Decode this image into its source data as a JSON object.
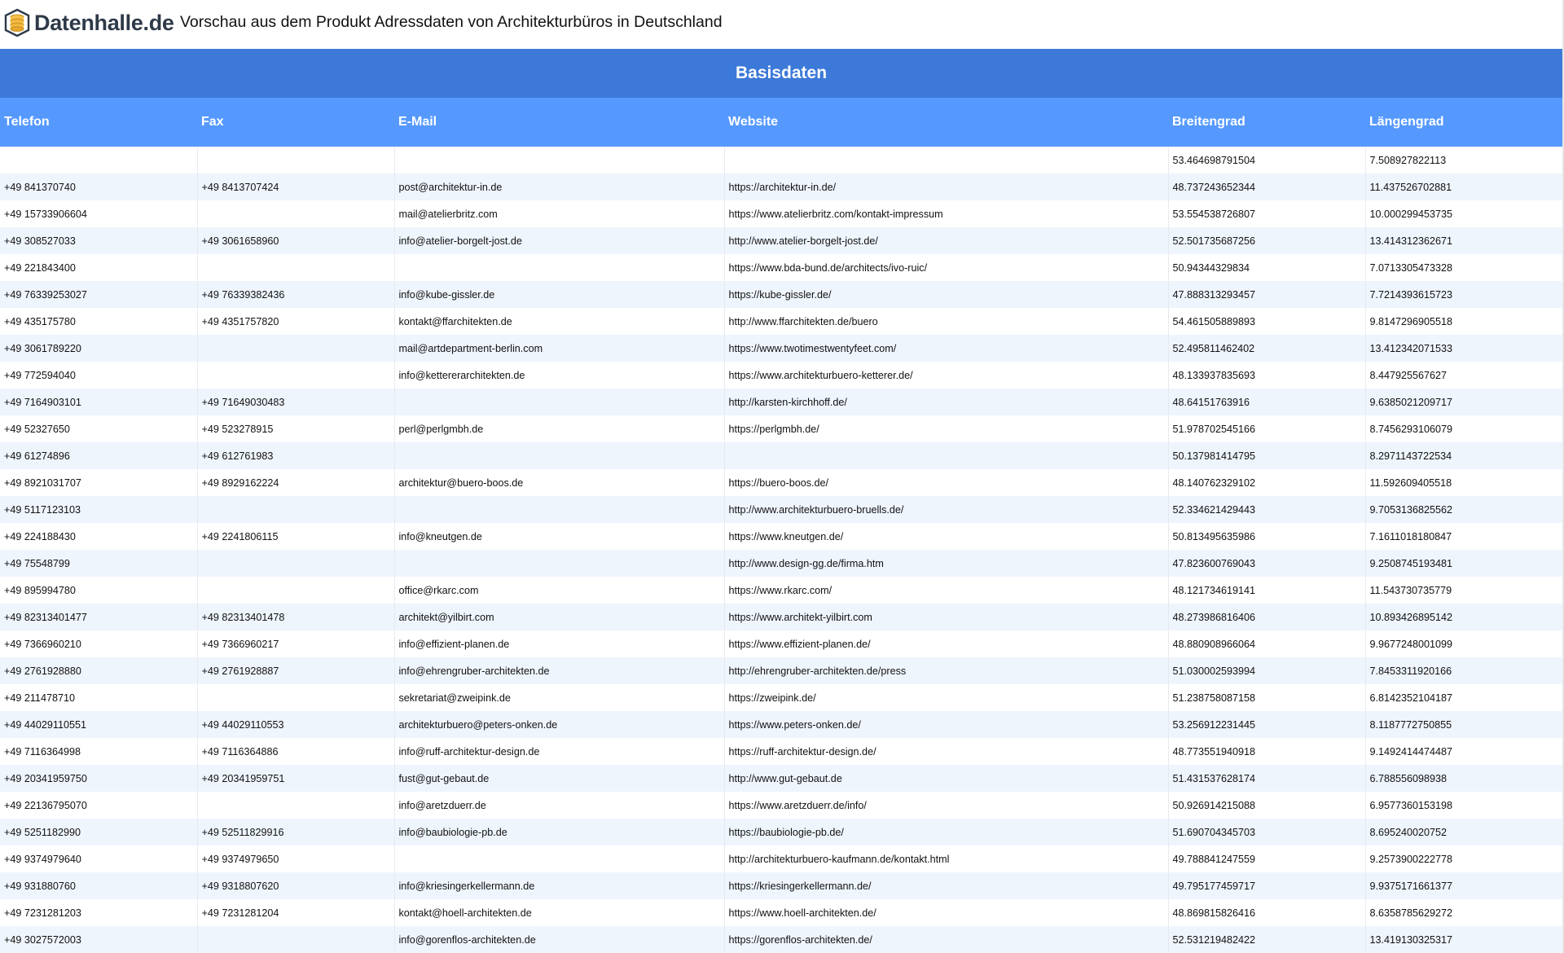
{
  "header": {
    "logo_text": "Datenhalle.de",
    "title": "Vorschau aus dem Produkt Adressdaten von Architekturbüros in Deutschland"
  },
  "table": {
    "group_header": "Basisdaten",
    "columns": [
      "Telefon",
      "Fax",
      "E-Mail",
      "Website",
      "Breitengrad",
      "Längengrad"
    ],
    "rows": [
      [
        "",
        "",
        "",
        "",
        "53.464698791504",
        "7.508927822113"
      ],
      [
        "+49 841370740",
        "+49 8413707424",
        "post@architektur-in.de",
        "https://architektur-in.de/",
        "48.737243652344",
        "11.437526702881"
      ],
      [
        "+49 15733906604",
        "",
        "mail@atelierbritz.com",
        "https://www.atelierbritz.com/kontakt-impressum",
        "53.554538726807",
        "10.000299453735"
      ],
      [
        "+49 308527033",
        "+49 3061658960",
        "info@atelier-borgelt-jost.de",
        "http://www.atelier-borgelt-jost.de/",
        "52.501735687256",
        "13.414312362671"
      ],
      [
        "+49 221843400",
        "",
        "",
        "https://www.bda-bund.de/architects/ivo-ruic/",
        "50.94344329834",
        "7.0713305473328"
      ],
      [
        "+49 76339253027",
        "+49 76339382436",
        "info@kube-gissler.de",
        "https://kube-gissler.de/",
        "47.888313293457",
        "7.7214393615723"
      ],
      [
        "+49 435175780",
        "+49 4351757820",
        "kontakt@ffarchitekten.de",
        "http://www.ffarchitekten.de/buero",
        "54.461505889893",
        "9.8147296905518"
      ],
      [
        "+49 3061789220",
        "",
        "mail@artdepartment-berlin.com",
        "https://www.twotimestwentyfeet.com/",
        "52.495811462402",
        "13.412342071533"
      ],
      [
        "+49 772594040",
        "",
        "info@kettererarchitekten.de",
        "https://www.architekturbuero-ketterer.de/",
        "48.133937835693",
        "8.447925567627"
      ],
      [
        "+49 7164903101",
        "+49 71649030483",
        "",
        "http://karsten-kirchhoff.de/",
        "48.64151763916",
        "9.6385021209717"
      ],
      [
        "+49 52327650",
        "+49 523278915",
        "perl@perlgmbh.de",
        "https://perlgmbh.de/",
        "51.978702545166",
        "8.7456293106079"
      ],
      [
        "+49 61274896",
        "+49 612761983",
        "",
        "",
        "50.137981414795",
        "8.2971143722534"
      ],
      [
        "+49 8921031707",
        "+49 8929162224",
        "architektur@buero-boos.de",
        "https://buero-boos.de/",
        "48.140762329102",
        "11.592609405518"
      ],
      [
        "+49 5117123103",
        "",
        "",
        "http://www.architekturbuero-bruells.de/",
        "52.334621429443",
        "9.7053136825562"
      ],
      [
        "+49 224188430",
        "+49 2241806115",
        "info@kneutgen.de",
        "https://www.kneutgen.de/",
        "50.813495635986",
        "7.1611018180847"
      ],
      [
        "+49 75548799",
        "",
        "",
        "http://www.design-gg.de/firma.htm",
        "47.823600769043",
        "9.2508745193481"
      ],
      [
        "+49 895994780",
        "",
        "office@rkarc.com",
        "https://www.rkarc.com/",
        "48.121734619141",
        "11.543730735779"
      ],
      [
        "+49 82313401477",
        "+49 82313401478",
        "architekt@yilbirt.com",
        "https://www.architekt-yilbirt.com",
        "48.273986816406",
        "10.893426895142"
      ],
      [
        "+49 7366960210",
        "+49 7366960217",
        "info@effizient-planen.de",
        "https://www.effizient-planen.de/",
        "48.880908966064",
        "9.9677248001099"
      ],
      [
        "+49 2761928880",
        "+49 2761928887",
        "info@ehrengruber-architekten.de",
        "http://ehrengruber-architekten.de/press",
        "51.030002593994",
        "7.8453311920166"
      ],
      [
        "+49 211478710",
        "",
        "sekretariat@zweipink.de",
        "https://zweipink.de/",
        "51.238758087158",
        "6.8142352104187"
      ],
      [
        "+49 44029110551",
        "+49 44029110553",
        "architekturbuero@peters-onken.de",
        "https://www.peters-onken.de/",
        "53.256912231445",
        "8.1187772750855"
      ],
      [
        "+49 7116364998",
        "+49 7116364886",
        "info@ruff-architektur-design.de",
        "https://ruff-architektur-design.de/",
        "48.773551940918",
        "9.1492414474487"
      ],
      [
        "+49 20341959750",
        "+49 20341959751",
        "fust@gut-gebaut.de",
        "http://www.gut-gebaut.de",
        "51.431537628174",
        "6.788556098938"
      ],
      [
        "+49 22136795070",
        "",
        "info@aretzduerr.de",
        "https://www.aretzduerr.de/info/",
        "50.926914215088",
        "6.9577360153198"
      ],
      [
        "+49 5251182990",
        "+49 52511829916",
        "info@baubiologie-pb.de",
        "https://baubiologie-pb.de/",
        "51.690704345703",
        "8.695240020752"
      ],
      [
        "+49 9374979640",
        "+49 9374979650",
        "",
        "http://architekturbuero-kaufmann.de/kontakt.html",
        "49.788841247559",
        "9.2573900222778"
      ],
      [
        "+49 931880760",
        "+49 9318807620",
        "info@kriesingerkellermann.de",
        "https://kriesingerkellermann.de/",
        "49.795177459717",
        "9.9375171661377"
      ],
      [
        "+49 7231281203",
        "+49 7231281204",
        "kontakt@hoell-architekten.de",
        "https://www.hoell-architekten.de/",
        "48.869815826416",
        "8.6358785629272"
      ],
      [
        "+49 3027572003",
        "",
        "info@gorenflos-architekten.de",
        "https://gorenflos-architekten.de/",
        "52.531219482422",
        "13.419130325317"
      ]
    ]
  }
}
